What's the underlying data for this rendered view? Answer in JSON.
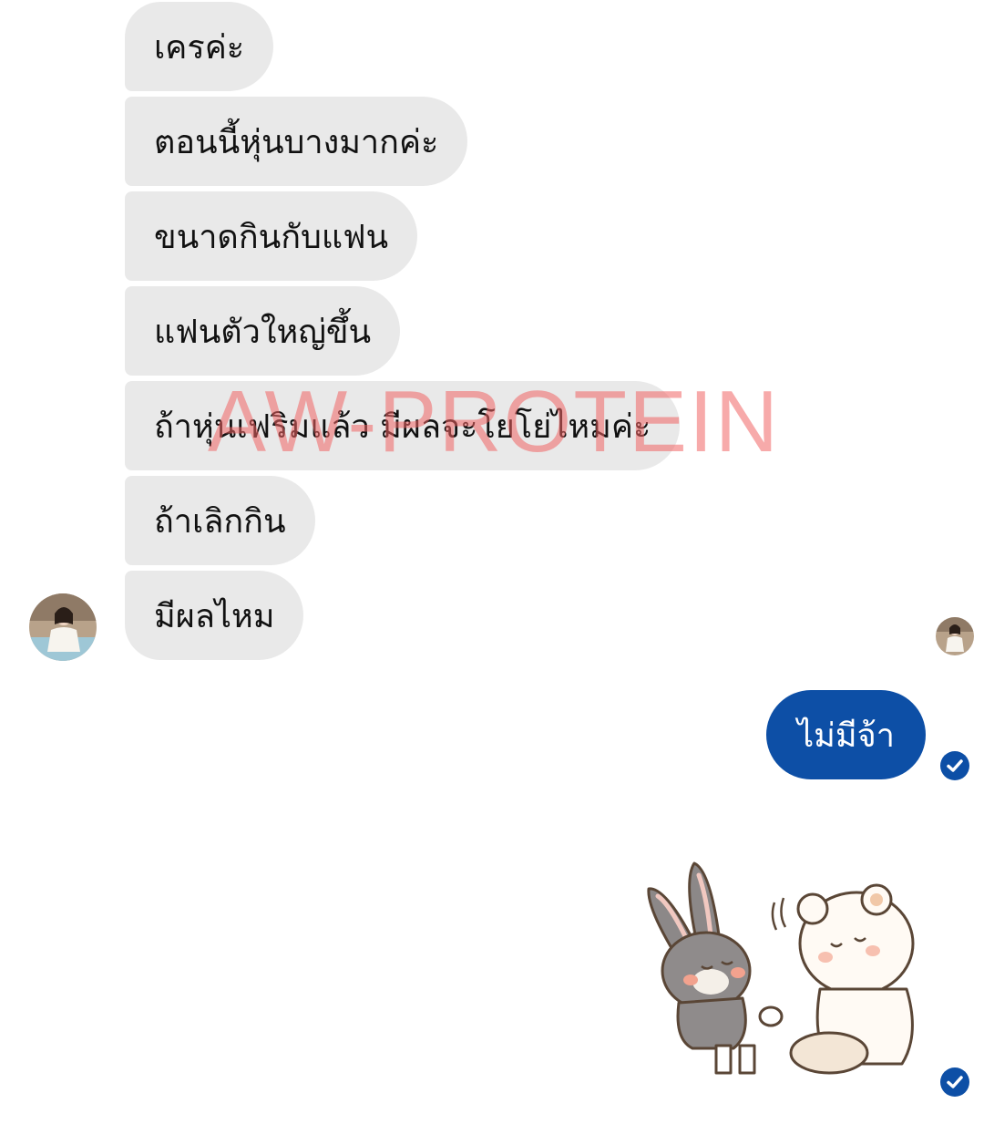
{
  "conversation": {
    "incoming": [
      {
        "text": "เครค่ะ"
      },
      {
        "text": "ตอนนี้หุ่นบางมากค่ะ"
      },
      {
        "text": "ขนาดกินกับแฟน"
      },
      {
        "text": "แฟนตัวใหญ่ขึ้น"
      },
      {
        "text": "ถ้าหุ่นเฟริมแล้ว มีผลจะโยโย่ไหมค่ะ"
      },
      {
        "text": "ถ้าเลิกกิน"
      },
      {
        "text": "มีผลไหม"
      }
    ],
    "outgoing": [
      {
        "text": "ไม่มีจ้า"
      }
    ]
  },
  "watermark": {
    "text": "AW-PROTEIN"
  },
  "colors": {
    "incoming_bubble": "#e9e9e9",
    "outgoing_bubble": "#0d4fa6",
    "seen_check": "#0d4fa6",
    "watermark": "#f06464"
  },
  "icons": {
    "contact_avatar": "contact-avatar-photo",
    "seen_indicator": "checkmark-circle-icon",
    "sticker": "bunny-and-bear-sticker"
  }
}
